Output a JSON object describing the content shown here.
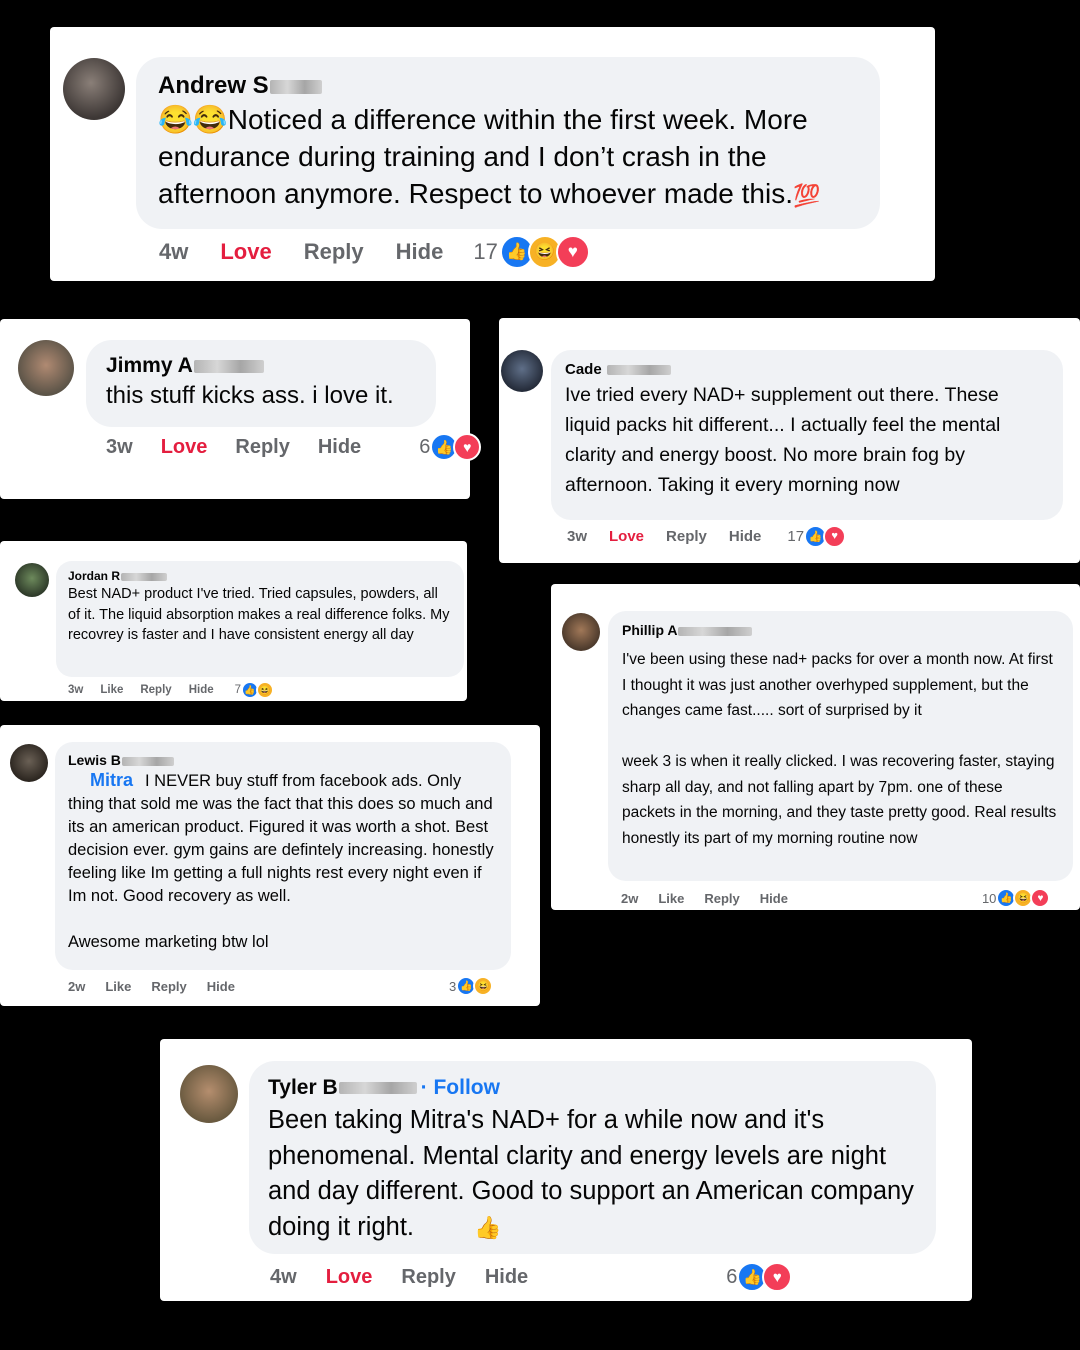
{
  "colors": {
    "background": "#000000",
    "like_blue": "#1877f2",
    "love_red": "#e41e3f",
    "bubble": "#f0f2f5",
    "meta_gray": "#65676b"
  },
  "comments": [
    {
      "name": "Andrew S",
      "emoji_lead": "😂😂",
      "text": "Noticed a difference within the first week. More endurance during training and I don’t crash in the afternoon anymore. Respect to whoever made this.",
      "emoji_tail": "💯",
      "time": "4w",
      "action1": "Love",
      "reply": "Reply",
      "hide": "Hide",
      "reaction_count": "17",
      "reactions": [
        "like-icon",
        "haha-icon",
        "heart-icon"
      ]
    },
    {
      "name": "Jimmy A",
      "text": "this stuff kicks ass. i love it.",
      "time": "3w",
      "action1": "Love",
      "reply": "Reply",
      "hide": "Hide",
      "reaction_count": "6",
      "reactions": [
        "like-icon",
        "heart-icon"
      ]
    },
    {
      "name": "Cade",
      "text": "Ive tried every NAD+ supplement out there. These liquid packs hit different... I actually feel the mental clarity and energy boost. No more brain fog by afternoon. Taking it every morning now",
      "time": "3w",
      "action1": "Love",
      "reply": "Reply",
      "hide": "Hide",
      "reaction_count": "17",
      "reactions": [
        "like-icon",
        "heart-icon"
      ]
    },
    {
      "name": "Jordan R",
      "text": "Best NAD+ product I've tried. Tried capsules, powders, all of it. The liquid absorption makes a real difference folks. My recovrey is faster and I have consistent energy all day",
      "time": "3w",
      "action1": "Like",
      "reply": "Reply",
      "hide": "Hide",
      "reaction_count": "7",
      "reactions": [
        "like-icon",
        "haha-icon"
      ]
    },
    {
      "name": "Phillip A",
      "text": "I've been using these nad+ packs for over a month now. At first I thought it was just another overhyped supplement, but the changes came fast..... sort of surprised by it\n\nweek 3 is when it really clicked. I was recovering faster, staying sharp all day, and not falling apart by 7pm. one of these packets in the morning, and they taste pretty good. Real results honestly its part of my morning routine now",
      "time": "2w",
      "action1": "Like",
      "reply": "Reply",
      "hide": "Hide",
      "reaction_count": "10",
      "reactions": [
        "like-icon",
        "haha-icon",
        "heart-icon"
      ]
    },
    {
      "name": "Lewis B",
      "mention": "Mitra",
      "text": "I NEVER buy stuff from facebook ads. Only thing that sold me was the fact that this does so much and its an american product. Figured it was worth a shot. Best decision ever. gym gains are defintely increasing. honestly feeling like Im getting a full nights rest every night even if Im not. Good recovery as well.\n\nAwesome marketing btw lol",
      "time": "2w",
      "action1": "Like",
      "reply": "Reply",
      "hide": "Hide",
      "reaction_count": "3",
      "reactions": [
        "like-icon",
        "haha-icon"
      ]
    },
    {
      "name": "Tyler B",
      "follow": "· Follow",
      "text": "Been taking Mitra's NAD+ for a while now and it's phenomenal. Mental clarity and energy levels are night and day different. Good to support an American company doing it right.",
      "emoji_tail": "👍",
      "time": "4w",
      "action1": "Love",
      "reply": "Reply",
      "hide": "Hide",
      "reaction_count": "6",
      "reactions": [
        "like-icon",
        "heart-icon"
      ]
    }
  ]
}
